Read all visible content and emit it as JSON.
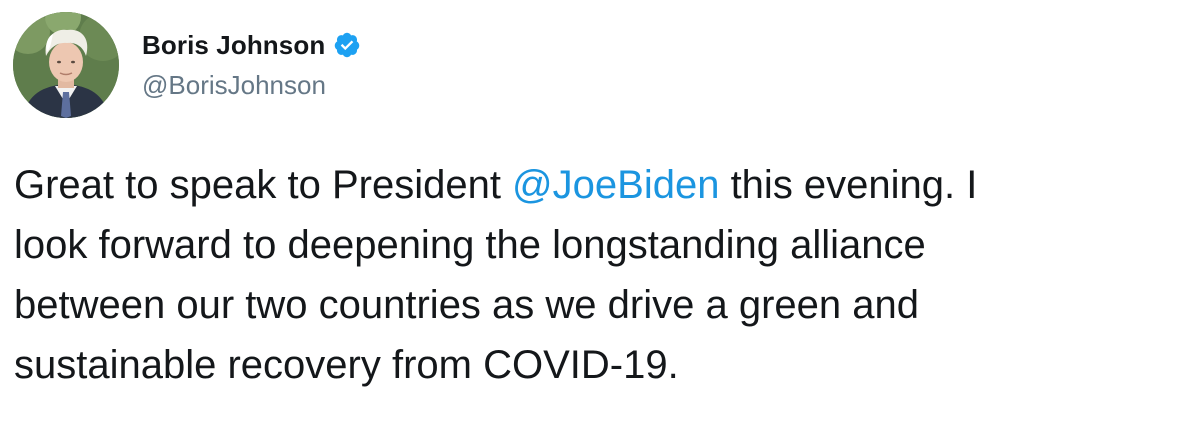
{
  "author": {
    "display_name": "Boris Johnson",
    "handle": "@BorisJohnson",
    "verified": true,
    "avatar_icon": "profile-photo"
  },
  "tweet": {
    "line1_before": "Great to speak to President ",
    "mention": "@JoeBiden",
    "line1_after": " this evening. I",
    "line2": "look forward to deepening the longstanding alliance",
    "line3": "between our two countries as we drive a green and",
    "line4": "sustainable recovery from COVID-19."
  },
  "colors": {
    "mention": "#1b95e0",
    "verified_badge": "#1da1f2",
    "handle": "#657786",
    "text": "#14171a"
  }
}
